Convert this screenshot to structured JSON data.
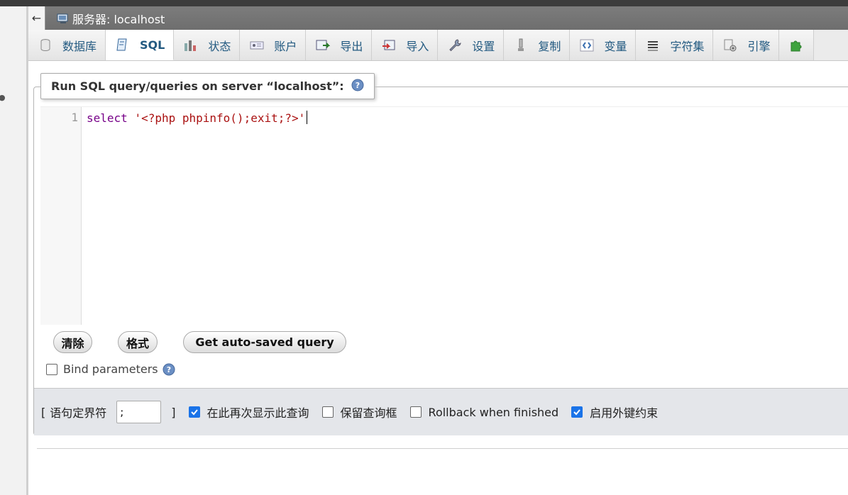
{
  "server": {
    "label": "服务器: localhost"
  },
  "tabs": [
    {
      "label": "数据库",
      "icon": "database-icon"
    },
    {
      "label": "SQL",
      "icon": "sql-icon",
      "active": true
    },
    {
      "label": "状态",
      "icon": "status-icon"
    },
    {
      "label": "账户",
      "icon": "accounts-icon"
    },
    {
      "label": "导出",
      "icon": "export-icon"
    },
    {
      "label": "导入",
      "icon": "import-icon"
    },
    {
      "label": "设置",
      "icon": "settings-wrench-icon"
    },
    {
      "label": "复制",
      "icon": "replication-icon"
    },
    {
      "label": "变量",
      "icon": "variables-icon"
    },
    {
      "label": "字符集",
      "icon": "charset-icon"
    },
    {
      "label": "引擎",
      "icon": "engines-icon"
    }
  ],
  "query_box": {
    "legend": "Run SQL query/queries on server “localhost”:",
    "line_number": "1",
    "code_keyword": "select",
    "code_string": "'<?php phpinfo();exit;?>'"
  },
  "buttons": {
    "clear": "清除",
    "format": "格式",
    "auto_saved": "Get auto-saved query"
  },
  "bind_parameters": {
    "label": "Bind parameters",
    "checked": false
  },
  "options": {
    "delimiter_open": "[",
    "delimiter_label": "语句定界符",
    "delimiter_value": ";",
    "delimiter_close": "]",
    "show_again": {
      "label": "在此再次显示此查询",
      "checked": true
    },
    "retain_box": {
      "label": "保留查询框",
      "checked": false
    },
    "rollback": {
      "label": "Rollback when finished",
      "checked": false
    },
    "foreign_keys": {
      "label": "启用外键约束",
      "checked": true
    }
  },
  "colors": {
    "tab_text": "#235a81",
    "checkbox_checked": "#1a73e8",
    "keyword": "#770088",
    "string": "#aa1111"
  }
}
